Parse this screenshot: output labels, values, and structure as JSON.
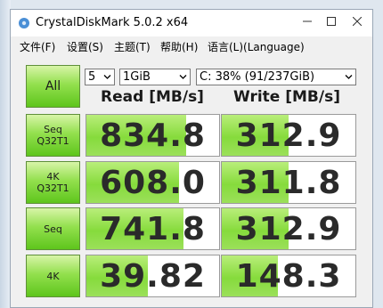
{
  "window": {
    "title": "CrystalDiskMark 5.0.2 x64"
  },
  "menu": [
    "文件(F)",
    "设置(S)",
    "主题(T)",
    "帮助(H)",
    "语言(L)(Language)"
  ],
  "controls": {
    "all_label": "All",
    "runs": "5",
    "size": "1GiB",
    "drive": "C: 38% (91/237GiB)"
  },
  "headers": {
    "read": "Read [MB/s]",
    "write": "Write [MB/s]"
  },
  "tests": [
    {
      "label_lines": [
        "Seq",
        "Q32T1"
      ],
      "read": "834.8",
      "write": "312.9",
      "read_fill": 0.75,
      "write_fill": 0.5
    },
    {
      "label_lines": [
        "4K",
        "Q32T1"
      ],
      "read": "608.0",
      "write": "311.8",
      "read_fill": 0.7,
      "write_fill": 0.5
    },
    {
      "label_lines": [
        "Seq"
      ],
      "read": "741.8",
      "write": "312.9",
      "read_fill": 0.73,
      "write_fill": 0.5
    },
    {
      "label_lines": [
        "4K"
      ],
      "read": "39.82",
      "write": "148.3",
      "read_fill": 0.46,
      "write_fill": 0.42
    }
  ]
}
